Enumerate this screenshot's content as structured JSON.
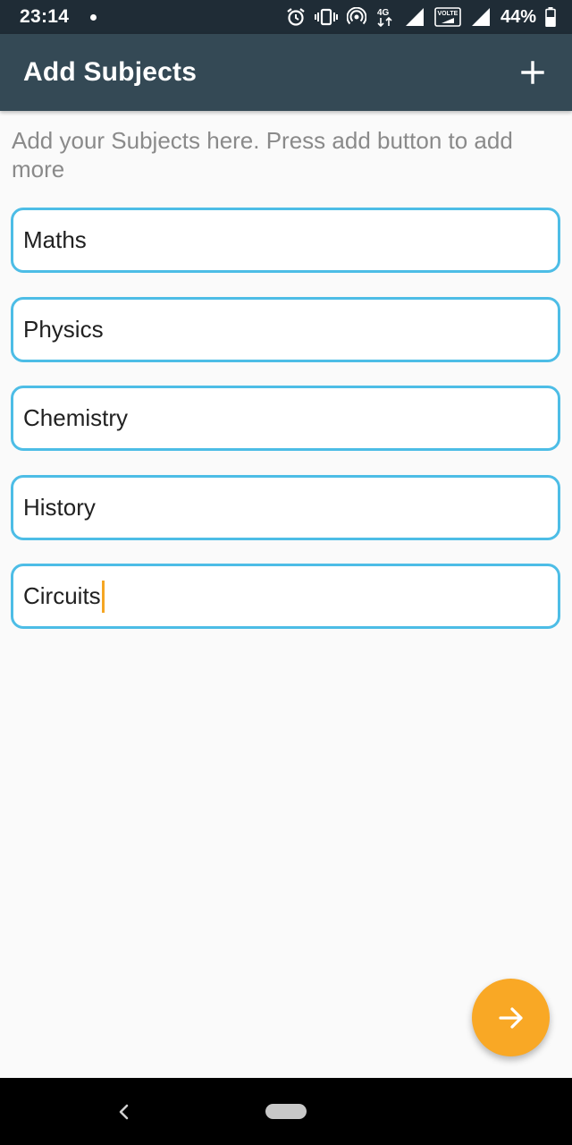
{
  "status_bar": {
    "time": "23:14",
    "network": "4G",
    "volte": "VOLTE",
    "battery": "44%",
    "icons": [
      "alarm-icon",
      "vibrate-icon",
      "hotspot-icon",
      "network-4g-icon",
      "signal-icon",
      "volte-icon",
      "signal-icon",
      "battery-icon"
    ]
  },
  "app_bar": {
    "title": "Add Subjects",
    "add_icon": "plus-icon"
  },
  "hint": "Add your Subjects here. Press add button to add more",
  "subjects": [
    {
      "value": "Maths"
    },
    {
      "value": "Physics"
    },
    {
      "value": "Chemistry"
    },
    {
      "value": "History"
    },
    {
      "value": "Circuits",
      "focused": true
    }
  ],
  "fab": {
    "icon": "arrow-right-icon"
  },
  "nav_bar": {
    "back_icon": "back-chevron-icon",
    "home_icon": "home-pill-icon"
  },
  "colors": {
    "status_bar": "#1f2c36",
    "app_bar": "#344955",
    "field_border": "#4dbde6",
    "cursor": "#f5a623",
    "fab": "#f9a825",
    "hint_text": "#8a8a8a",
    "background": "#fafafa"
  }
}
